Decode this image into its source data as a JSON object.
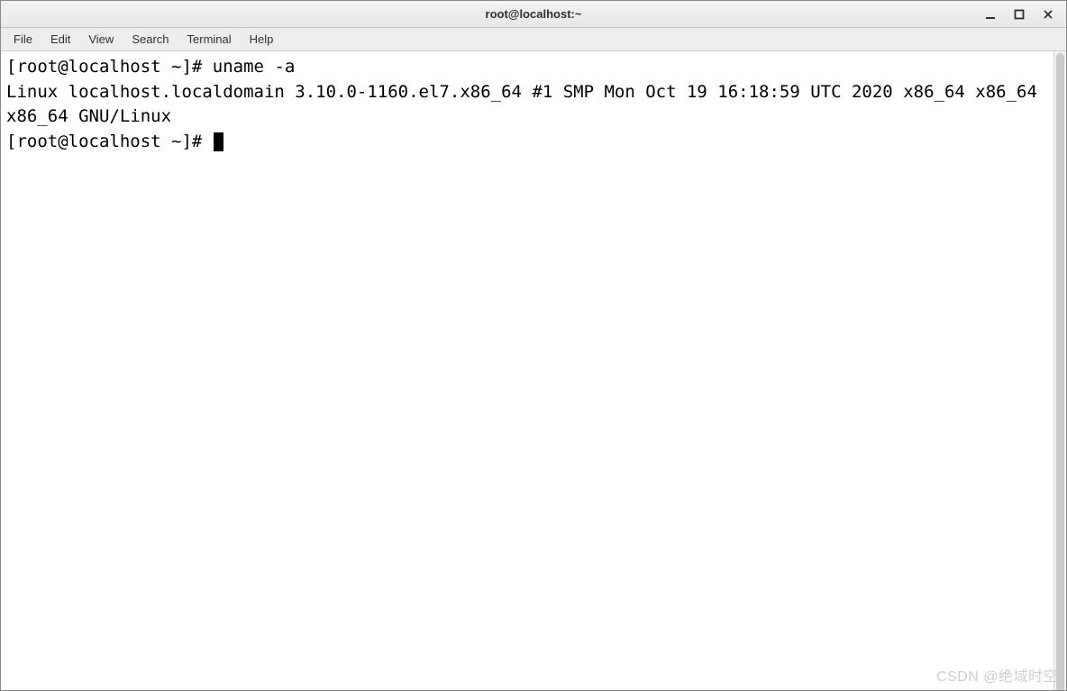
{
  "window": {
    "title": "root@localhost:~"
  },
  "menubar": {
    "items": [
      "File",
      "Edit",
      "View",
      "Search",
      "Terminal",
      "Help"
    ]
  },
  "terminal": {
    "lines": [
      {
        "prompt": "[root@localhost ~]# ",
        "command": "uname -a"
      },
      {
        "output": "Linux localhost.localdomain 3.10.0-1160.el7.x86_64 #1 SMP Mon Oct 19 16:18:59 UTC 2020 x86_64 x86_64 x86_64 GNU/Linux"
      },
      {
        "prompt": "[root@localhost ~]# ",
        "command": "",
        "cursor": true
      }
    ]
  },
  "watermark": "CSDN @绝域时空"
}
